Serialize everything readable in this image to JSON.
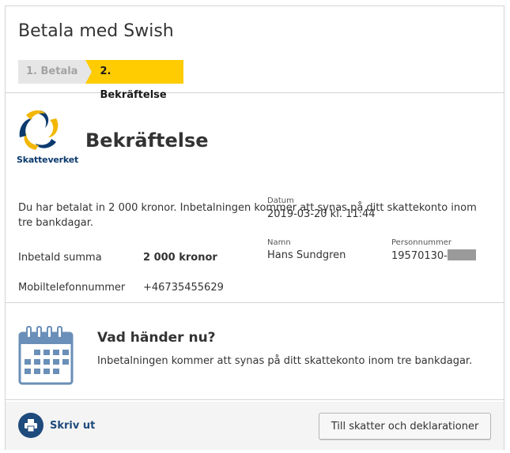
{
  "page": {
    "title": "Betala med Swish"
  },
  "steps": [
    {
      "label": "1. Betala",
      "state": "done"
    },
    {
      "label": "2. Bekräftelse",
      "state": "active"
    }
  ],
  "logo": {
    "text": "Skatteverket"
  },
  "confirmation": {
    "title": "Bekräftelse",
    "datum_label": "Datum",
    "datum_value": "2019-03-20 kl. 11:44",
    "namn_label": "Namn",
    "namn_value": "Hans Sundgren",
    "personnummer_label": "Personnummer",
    "personnummer_value": "19570130-",
    "paragraph": "Du har betalat in 2 000 kronor. Inbetalningen kommer att synas på ditt skattekonto inom tre bankdagar.",
    "rows": [
      {
        "label": "Inbetald summa",
        "value": "2 000 kronor"
      },
      {
        "label": "Mobiltelefonnummer",
        "value": "+46735455629"
      }
    ]
  },
  "next": {
    "icon": "calendar-icon",
    "title": "Vad händer nu?",
    "text": "Inbetalningen kommer att synas på ditt skattekonto inom tre bankdagar."
  },
  "footer": {
    "print_label": "Skriv ut",
    "print_icon": "printer-icon",
    "action_label": "Till skatter och deklarationer"
  },
  "colors": {
    "accent": "#fecc00",
    "brand_blue": "#1f4a7c",
    "step_done_bg": "#e6e6e6",
    "calendar_blue": "#6a8fb8"
  }
}
